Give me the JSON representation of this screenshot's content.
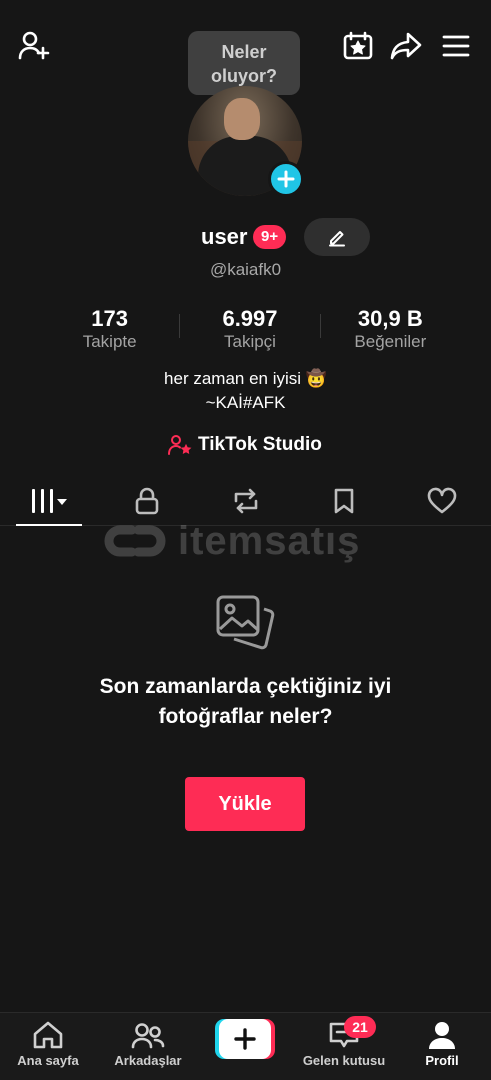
{
  "header": {
    "bubble_line1": "Neler",
    "bubble_line2": "oluyor?",
    "icons": [
      "add-friend-icon",
      "calendar-star-icon",
      "share-icon",
      "menu-icon"
    ]
  },
  "profile": {
    "username": "user",
    "badge": "9+",
    "handle": "@kaiafk0",
    "stats": [
      {
        "value": "173",
        "label": "Takipte"
      },
      {
        "value": "6.997",
        "label": "Takipçi"
      },
      {
        "value": "30,9 B",
        "label": "Beğeniler"
      }
    ],
    "bio_line1": "her zaman en iyisi 🤠",
    "bio_line2": "~KAİ#AFK",
    "studio_label": "TikTok Studio"
  },
  "tabs": [
    "videos-grid-icon",
    "lock-icon",
    "repost-icon",
    "bookmark-icon",
    "heart-icon"
  ],
  "watermark": "itemsatış",
  "empty_state": {
    "title": "Son zamanlarda çektiğiniz iyi fotoğraflar neler?",
    "button": "Yükle"
  },
  "bottom_nav": {
    "home": "Ana sayfa",
    "friends": "Arkadaşlar",
    "inbox": "Gelen kutusu",
    "inbox_badge": "21",
    "profile": "Profil"
  },
  "colors": {
    "accent": "#fe2c55",
    "cyan": "#20c5e6",
    "background": "#161616"
  }
}
